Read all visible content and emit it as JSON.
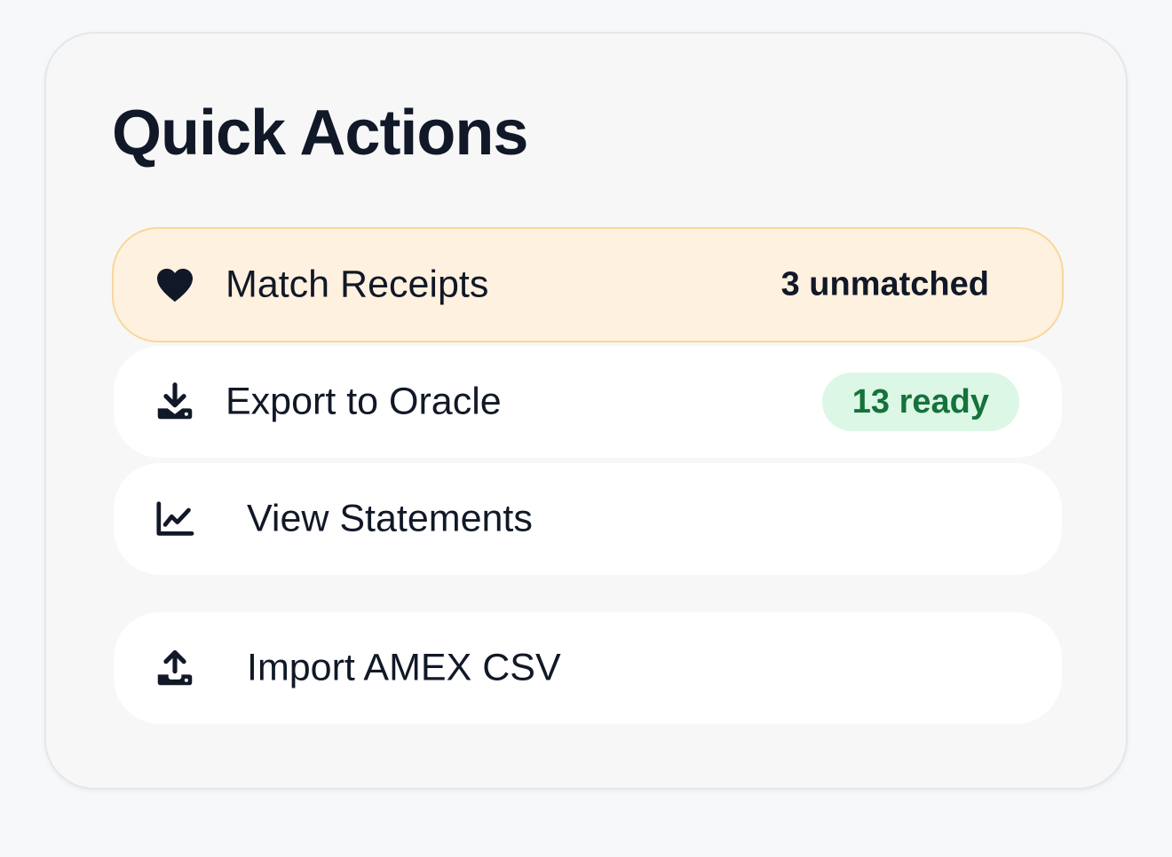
{
  "panel": {
    "title": "Quick Actions"
  },
  "actions": [
    {
      "label": "Match Receipts",
      "icon": "heart-icon",
      "meta": "3 unmatched",
      "highlighted": true
    },
    {
      "label": "Export to Oracle",
      "icon": "download-icon",
      "badge": "13 ready",
      "badge_color": "#15723b",
      "badge_bg": "#dcf7e6"
    },
    {
      "label": "View Statements",
      "icon": "line-chart-icon"
    },
    {
      "label": "Import AMEX CSV",
      "icon": "upload-icon"
    }
  ],
  "colors": {
    "highlight_bg": "#fff1df",
    "highlight_border": "#f8d79a",
    "text": "#111827"
  }
}
